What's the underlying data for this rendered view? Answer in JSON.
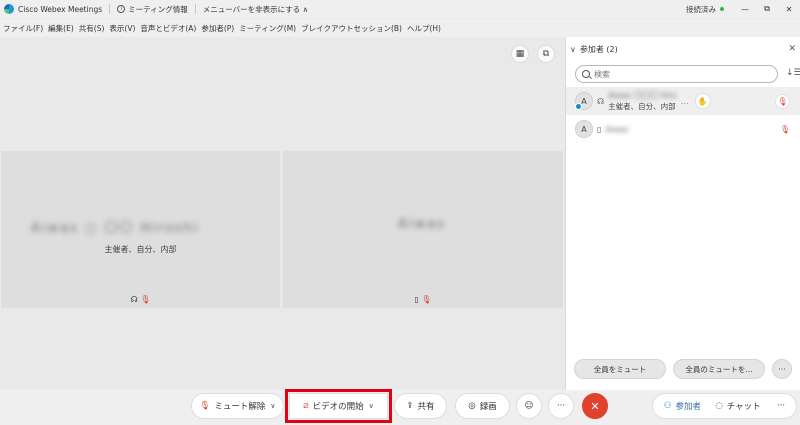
{
  "titlebar": {
    "app_name": "Cisco Webex Meetings",
    "meeting_info": "ミーティング情報",
    "hide_menubar": "メニューバーを非表示にする ∧",
    "connection_status": "接続済み",
    "status_color": "#2eb84b",
    "minimize": "—",
    "restore": "⧉",
    "close": "✕"
  },
  "menubar": {
    "items": [
      "ファイル(F)",
      "編集(E)",
      "共有(S)",
      "表示(V)",
      "音声とビデオ(A)",
      "参加者(P)",
      "ミーティング(M)",
      "ブレイクアウトセッション(B)",
      "ヘルプ(H)"
    ]
  },
  "stage": {
    "layout_icon": "grid-icon",
    "popout_icon": "popout-icon",
    "tile1": {
      "role": "主催者、自分、内部",
      "icons": [
        "headset-icon",
        "mic-muted-icon"
      ]
    },
    "tile2": {
      "icons": [
        "phone-icon",
        "mic-muted-icon"
      ]
    }
  },
  "panel": {
    "title": "参加者 (2)",
    "search_placeholder": "検索",
    "participants": [
      {
        "initial": "A",
        "role": "主催者、自分、内部",
        "ellipsis": "…"
      },
      {
        "initial": "A"
      }
    ],
    "mute_all": "全員をミュート",
    "unmute_all": "全員のミュートを...",
    "more": "···"
  },
  "controlbar": {
    "unmute": "ミュート解除",
    "start_video": "ビデオの開始",
    "share": "共有",
    "record": "録画",
    "more": "···",
    "participants": "参加者",
    "chat": "チャット",
    "end_color": "#e0412d",
    "highlight_color": "#e3000f"
  }
}
